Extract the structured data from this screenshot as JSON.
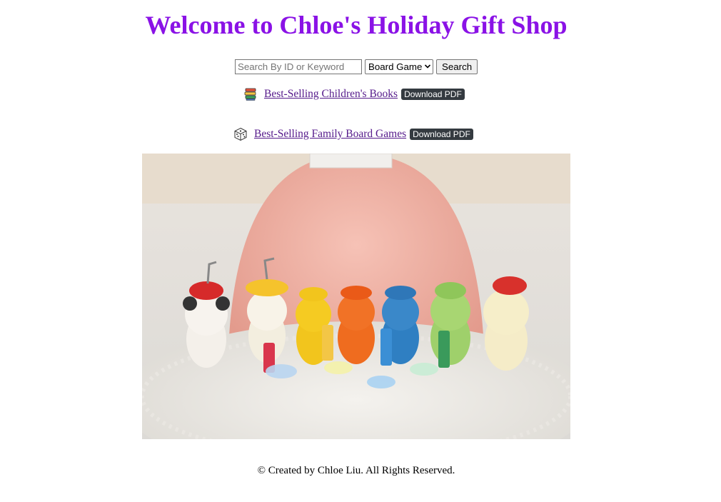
{
  "header": {
    "title": "Welcome to Chloe's Holiday Gift Shop"
  },
  "search": {
    "placeholder": "Search By ID or Keyword",
    "value": "",
    "category_selected": "Board Game",
    "button_label": "Search"
  },
  "links": [
    {
      "label": "Best-Selling Children's Books",
      "icon": "books-icon",
      "badge": "Download PDF"
    },
    {
      "label": "Best-Selling Family Board Games",
      "icon": "dice-icon",
      "badge": "Download PDF"
    }
  ],
  "hero": {
    "description_icon": "toy-bears-photo"
  },
  "footer": {
    "text": "© Created by Chloe Liu. All Rights Reserved."
  },
  "colors": {
    "title": "#8a12e6",
    "link": "#551a8b",
    "badge_bg": "#343a40"
  }
}
